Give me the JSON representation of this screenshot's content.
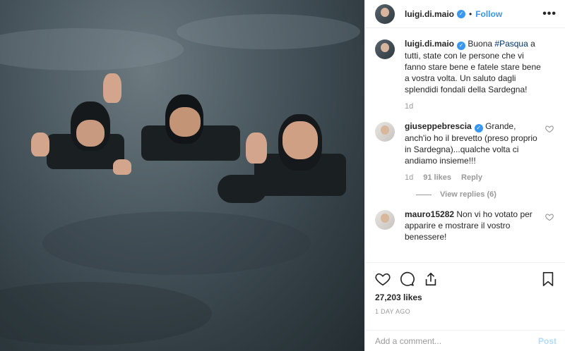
{
  "post": {
    "username": "luigi.di.maio",
    "dot": "•",
    "follow_label": "Follow",
    "more_label": "•••"
  },
  "caption": {
    "username": "luigi.di.maio",
    "text_before": "Buona ",
    "hashtag": "#Pasqua",
    "text_after": " a tutti, state con le persone che vi fanno stare bene e fatele stare bene a vostra volta. Un saluto dagli splendidi fondali della Sardegna!",
    "time": "1d"
  },
  "comments": [
    {
      "username": "giuseppebrescia",
      "text": "Grande, anch'io ho il brevetto (preso proprio in Sardegna)...qualche volta ci andiamo insieme!!!",
      "time": "1d",
      "likes": "91 likes",
      "reply_label": "Reply",
      "view_replies": "View replies (6)"
    },
    {
      "username": "mauro15282",
      "text": "Non vi ho votato per apparire e mostrare il vostro benessere!"
    }
  ],
  "footer": {
    "likes": "27,203 likes",
    "time_ago": "1 DAY AGO",
    "comment_placeholder": "Add a comment...",
    "post_label": "Post"
  },
  "colors": {
    "accent": "#3897f0",
    "post_disabled": "#b3dbff",
    "hashtag": "#003569"
  },
  "icons": [
    "heart-icon",
    "comment-icon",
    "share-icon",
    "bookmark-icon",
    "more-icon",
    "verified-icon"
  ]
}
